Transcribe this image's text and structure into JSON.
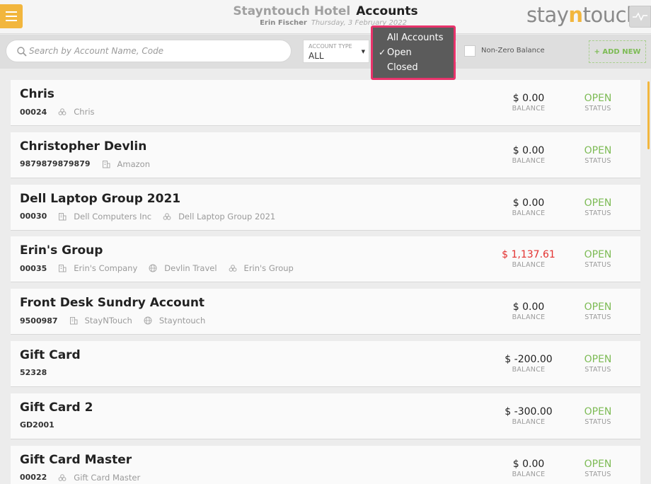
{
  "header": {
    "hotel": "Stayntouch Hotel",
    "page_title": "Accounts",
    "user": "Erin Fischer",
    "date": "Thursday, 3 February 2022",
    "logo": {
      "pre": "stay",
      "n": "n",
      "post": "touch"
    },
    "menu_icon": "hamburger-icon",
    "pulse_icon": "pulse-icon"
  },
  "filters": {
    "search_placeholder": "Search by Account Name, Code",
    "account_type_label": "ACCOUNT TYPE",
    "account_type_value": "ALL",
    "non_zero_label": "Non-Zero Balance",
    "add_new_label": "+ ADD NEW",
    "status_options": [
      "All Accounts",
      "Open",
      "Closed"
    ],
    "status_selected": "Open",
    "check_glyph": "✓"
  },
  "captions": {
    "balance": "BALANCE",
    "status": "STATUS"
  },
  "accounts": [
    {
      "name": "Chris",
      "code": "00024",
      "meta": [
        {
          "icon": "group-icon",
          "text": "Chris"
        }
      ],
      "balance": "$ 0.00",
      "negative": false,
      "status": "OPEN"
    },
    {
      "name": "Christopher Devlin",
      "code": "9879879879879",
      "meta": [
        {
          "icon": "company-icon",
          "text": "Amazon"
        }
      ],
      "balance": "$ 0.00",
      "negative": false,
      "status": "OPEN"
    },
    {
      "name": "Dell Laptop Group 2021",
      "code": "00030",
      "meta": [
        {
          "icon": "company-icon",
          "text": "Dell Computers Inc"
        },
        {
          "icon": "group-icon",
          "text": "Dell Laptop Group 2021"
        }
      ],
      "balance": "$ 0.00",
      "negative": false,
      "status": "OPEN"
    },
    {
      "name": "Erin's Group",
      "code": "00035",
      "meta": [
        {
          "icon": "company-icon",
          "text": "Erin's Company"
        },
        {
          "icon": "globe-icon",
          "text": "Devlin Travel"
        },
        {
          "icon": "group-icon",
          "text": "Erin's Group"
        }
      ],
      "balance": "$ 1,137.61",
      "negative": true,
      "status": "OPEN"
    },
    {
      "name": "Front Desk Sundry Account",
      "code": "9500987",
      "meta": [
        {
          "icon": "company-icon",
          "text": "StayNTouch"
        },
        {
          "icon": "globe-icon",
          "text": "Stayntouch"
        }
      ],
      "balance": "$ 0.00",
      "negative": false,
      "status": "OPEN"
    },
    {
      "name": "Gift Card",
      "code": "52328",
      "meta": [],
      "balance": "$ -200.00",
      "negative": false,
      "status": "OPEN"
    },
    {
      "name": "Gift Card 2",
      "code": "GD2001",
      "meta": [],
      "balance": "$ -300.00",
      "negative": false,
      "status": "OPEN"
    },
    {
      "name": "Gift Card Master",
      "code": "00022",
      "meta": [
        {
          "icon": "group-icon",
          "text": "Gift Card Master"
        }
      ],
      "balance": "$ 0.00",
      "negative": false,
      "status": "OPEN"
    }
  ],
  "colors": {
    "accent": "#f2b63d",
    "open": "#7dbb55",
    "negative": "#e3302f",
    "highlight": "#e8336b"
  }
}
